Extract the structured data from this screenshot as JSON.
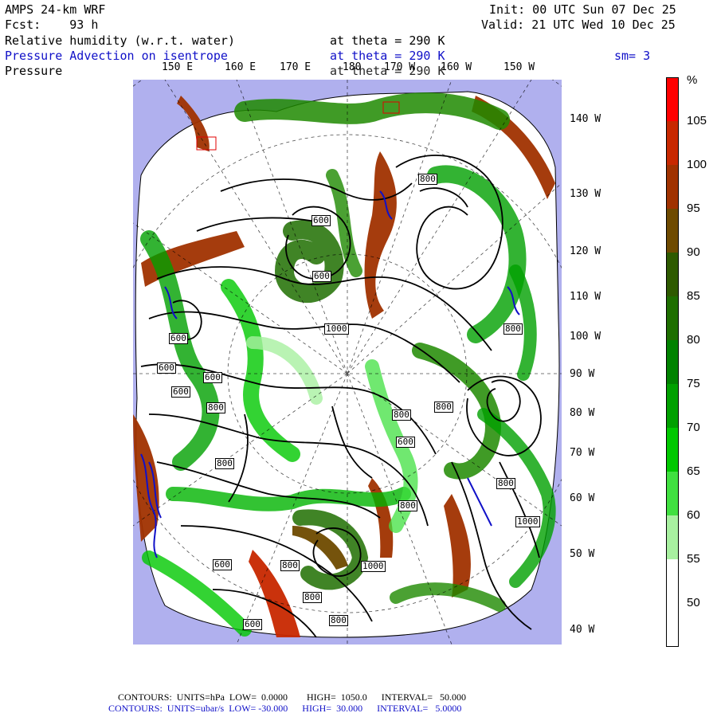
{
  "header": {
    "model": "AMPS 24-km WRF",
    "init": "Init: 00 UTC Sun 07 Dec 25",
    "fcst": "Fcst:    93 h",
    "valid": "Valid: 21 UTC Wed 10 Dec 25",
    "field1": "Relative humidity (w.r.t. water)",
    "field1_level": "at theta = 290 K",
    "field2": "Pressure Advection on isentrope",
    "field2_level": "at theta = 290 K",
    "field2_sm": "sm= 3",
    "field3": "Pressure",
    "field3_level": "at theta = 290 K"
  },
  "longitude_labels_top": [
    "150 E",
    "160 E",
    "170 E",
    "180",
    "170 W",
    "160 W",
    "150 W"
  ],
  "longitude_labels_right": [
    "140 W",
    "130 W",
    "120 W",
    "110 W",
    "100 W",
    "90 W",
    "80 W",
    "70 W",
    "60 W",
    "50 W",
    "40 W"
  ],
  "contour_labels": [
    "800",
    "600",
    "600",
    "800",
    "600",
    "600",
    "600",
    "800",
    "600",
    "800",
    "600",
    "800",
    "1000",
    "800",
    "800",
    "600",
    "800",
    "1000",
    "800",
    "800",
    "600",
    "1000",
    "800"
  ],
  "colorbar": {
    "unit": "%",
    "labels": [
      "105",
      "100",
      "95",
      "90",
      "85",
      "80",
      "75",
      "70",
      "65",
      "60",
      "55",
      "50"
    ],
    "colors": [
      "#ff0000",
      "#c82800",
      "#a03200",
      "#6e4a00",
      "#2e5a00",
      "#1e6e00",
      "#008200",
      "#00a000",
      "#00c800",
      "#40e040",
      "#a8f0a0",
      "#ffffff",
      "#ffffff"
    ]
  },
  "footer": {
    "line1": "CONTOURS:  UNITS=hPa  LOW=  0.0000        HIGH=  1050.0      INTERVAL=   50.000",
    "line2": "CONTOURS:  UNITS=ubar/s  LOW= -30.000      HIGH=  30.000      INTERVAL=   5.0000"
  },
  "colors": {
    "ocean": "#b0b0ee",
    "land_white": "#ffffff",
    "rh_dark_red": "#a03200",
    "rh_green": "#1e8a00",
    "contour": "#000000",
    "advection": "#1010c8"
  }
}
